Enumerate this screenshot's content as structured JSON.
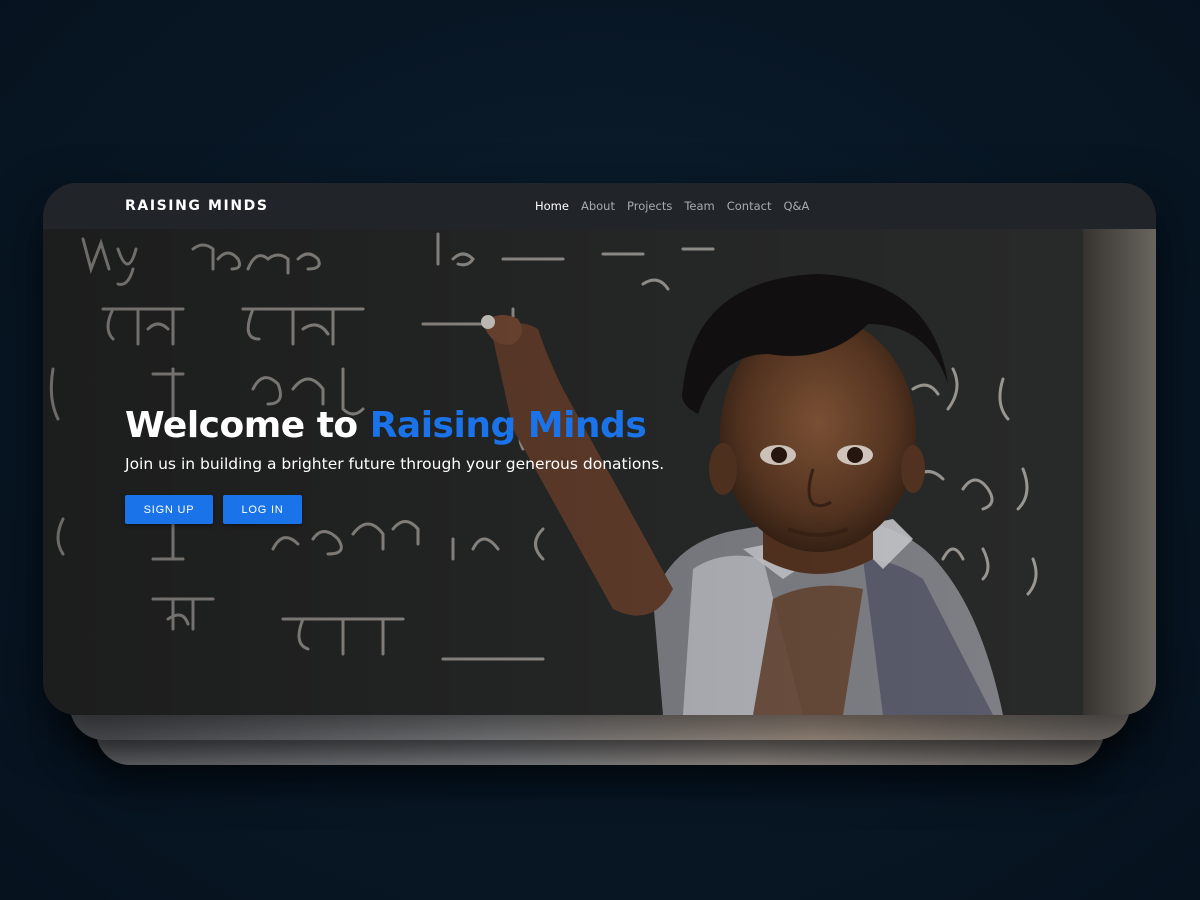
{
  "brand": "RAISING MINDS",
  "nav": {
    "items": [
      {
        "label": "Home",
        "active": true
      },
      {
        "label": "About",
        "active": false
      },
      {
        "label": "Projects",
        "active": false
      },
      {
        "label": "Team",
        "active": false
      },
      {
        "label": "Contact",
        "active": false
      },
      {
        "label": "Q&A",
        "active": false
      }
    ]
  },
  "hero": {
    "title_prefix": "Welcome to ",
    "title_accent": "Raising Minds",
    "subtitle": "Join us in building a brighter future through your generous donations.",
    "signup_label": "SIGN UP",
    "login_label": "LOG IN",
    "image_alt_icon": "boy-at-chalkboard-photo"
  },
  "colors": {
    "page_background": "#0b1a29",
    "navbar": "#212529",
    "accent": "#1a73e8",
    "text": "#ffffff",
    "nav_inactive": "#a7abb0"
  }
}
